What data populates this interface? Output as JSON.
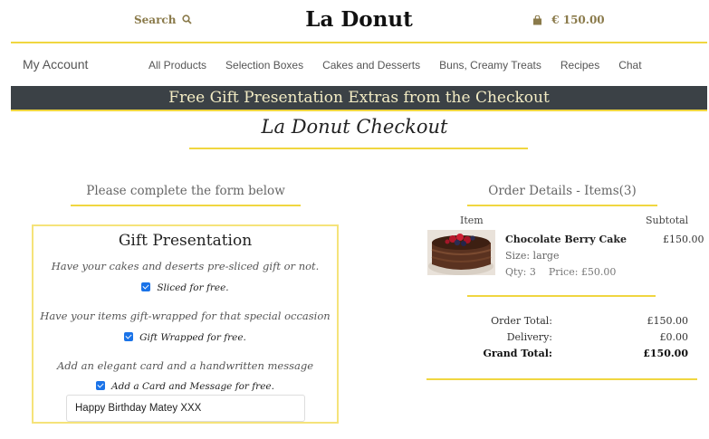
{
  "header": {
    "search_label": "Search",
    "brand": "La Donut",
    "cart_total": "€ 150.00"
  },
  "nav": {
    "account": "My Account",
    "links": [
      "All Products",
      "Selection Boxes",
      "Cakes and Desserts",
      "Buns, Creamy Treats",
      "Recipes",
      "Chat"
    ]
  },
  "banner": "Free Gift Presentation Extras from the Checkout",
  "page_title": "La Donut Checkout",
  "form": {
    "heading": "Please complete the form below",
    "gift_title": "Gift Presentation",
    "slice_desc": "Have your cakes and deserts pre-sliced gift or not.",
    "slice_label": "Sliced for free.",
    "wrap_desc": "Have your items gift-wrapped for that special occasion",
    "wrap_label": "Gift Wrapped for free.",
    "card_desc": "Add an elegant card and a handwritten message",
    "card_label": "Add a Card and Message for free.",
    "message_value": "Happy Birthday Matey XXX"
  },
  "order": {
    "heading": "Order Details - Items(3)",
    "col_item": "Item",
    "col_subtotal": "Subtotal",
    "product": {
      "name": "Chocolate Berry Cake",
      "size": "Size: large",
      "qty": "Qty: 3",
      "price": "Price: £50.00",
      "subtotal": "£150.00"
    },
    "order_total_label": "Order Total:",
    "order_total": "£150.00",
    "delivery_label": "Delivery:",
    "delivery": "£0.00",
    "grand_total_label": "Grand Total:",
    "grand_total": "£150.00"
  },
  "colors": {
    "accent": "#f0d640",
    "banner_bg": "#3b4146",
    "checkbox": "#1a73e8"
  }
}
